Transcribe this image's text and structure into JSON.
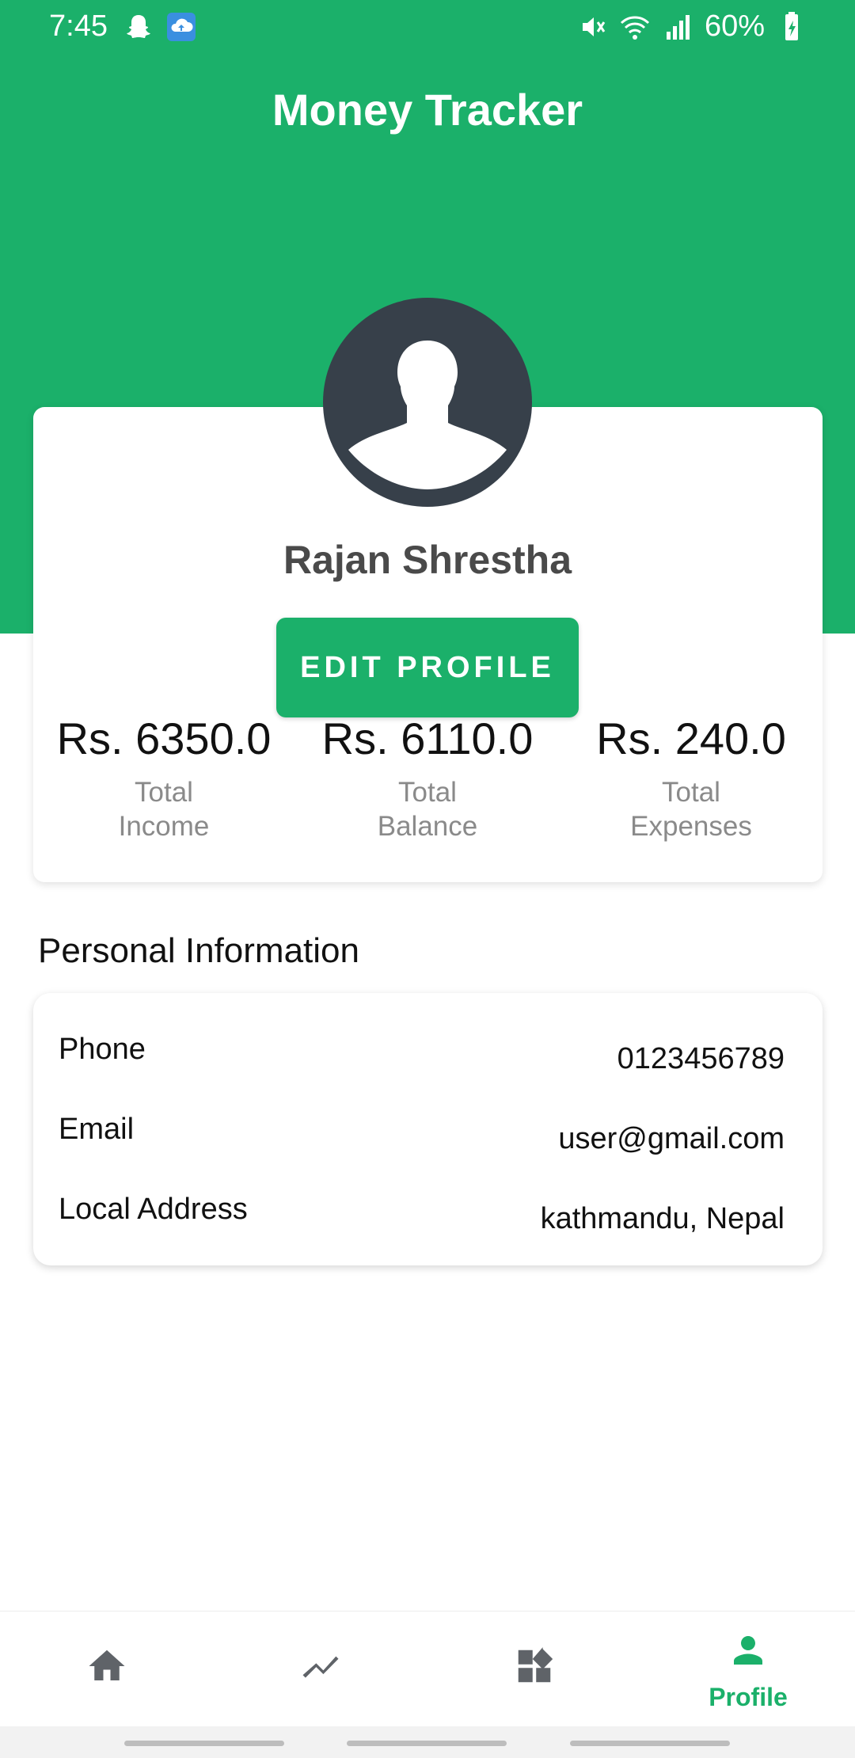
{
  "status_bar": {
    "time": "7:45",
    "battery": "60%",
    "icons": [
      "snapchat-icon",
      "cloud-upload-icon",
      "mute-icon",
      "wifi-icon",
      "signal-icon",
      "battery-icon"
    ]
  },
  "app": {
    "title": "Money Tracker",
    "accent_color": "#1bb06a"
  },
  "profile": {
    "name": "Rajan Shrestha",
    "edit_button_label": "EDIT PROFILE",
    "avatar_icon": "person-silhouette-icon"
  },
  "stats": [
    {
      "value": "Rs. 6350.0",
      "label_line1": "Total",
      "label_line2": "Income"
    },
    {
      "value": "Rs. 6110.0",
      "label_line1": "Total",
      "label_line2": "Balance"
    },
    {
      "value": "Rs. 240.0",
      "label_line1": "Total",
      "label_line2": "Expenses"
    }
  ],
  "personal_info": {
    "title": "Personal Information",
    "rows": [
      {
        "label": "Phone",
        "value": "0123456789"
      },
      {
        "label": "Email",
        "value": "user@gmail.com"
      },
      {
        "label": "Local Address",
        "value": "kathmandu, Nepal"
      }
    ]
  },
  "bottom_nav": {
    "items": [
      {
        "icon": "home-icon",
        "label": "",
        "active": false
      },
      {
        "icon": "trending-icon",
        "label": "",
        "active": false
      },
      {
        "icon": "dashboard-icon",
        "label": "",
        "active": false
      },
      {
        "icon": "person-icon",
        "label": "Profile",
        "active": true
      }
    ]
  }
}
